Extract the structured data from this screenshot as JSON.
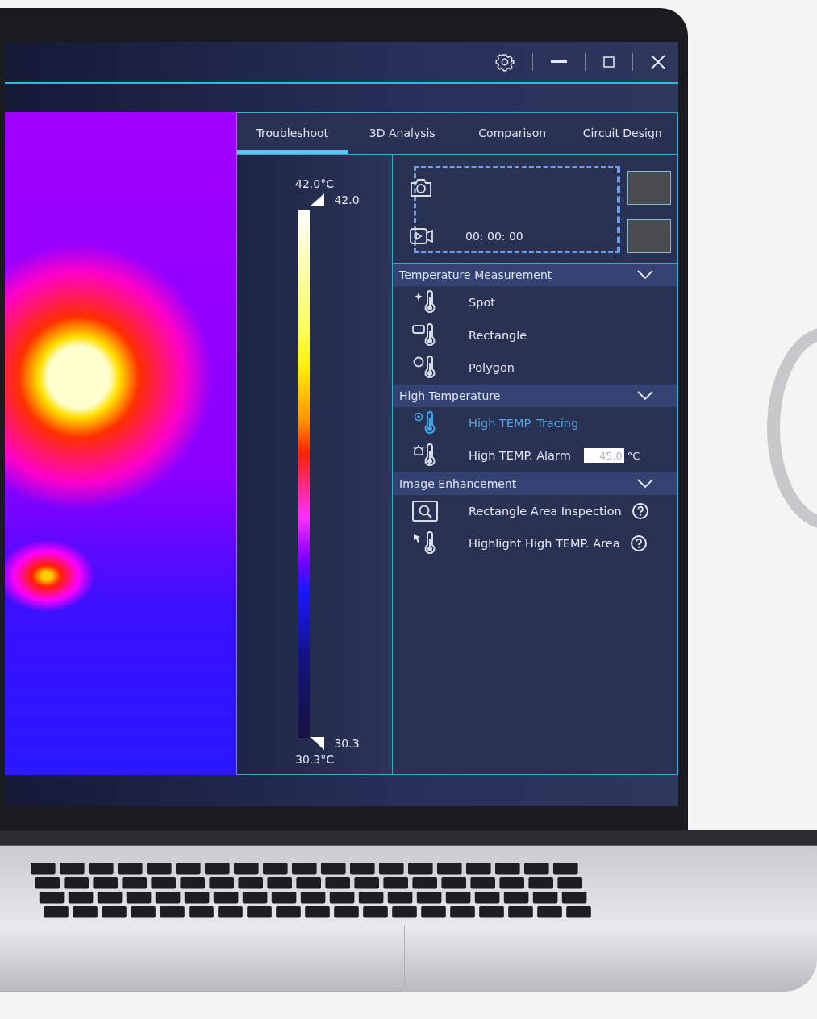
{
  "tabs": [
    {
      "label": "Troubleshoot",
      "selected": true
    },
    {
      "label": "3D Analysis",
      "selected": false
    },
    {
      "label": "Comparison",
      "selected": false
    },
    {
      "label": "Circuit Design",
      "selected": false
    }
  ],
  "color_scale": {
    "max_label": "42.0°C",
    "max_marker": "42.0",
    "min_marker": "30.3",
    "min_label": "30.3°C"
  },
  "capture": {
    "timer": "00: 00: 00"
  },
  "sections": [
    {
      "title": "Temperature Measurement",
      "expanded": true,
      "items": [
        {
          "kind": "spot",
          "label": "Spot",
          "selected": false
        },
        {
          "kind": "rectangle",
          "label": "Rectangle",
          "selected": false
        },
        {
          "kind": "polygon",
          "label": "Polygon",
          "selected": false
        }
      ]
    },
    {
      "title": "High Temperature",
      "expanded": true,
      "items": [
        {
          "kind": "tracing",
          "label": "High TEMP. Tracing",
          "selected": true
        },
        {
          "kind": "alarm",
          "label": "High TEMP. Alarm",
          "selected": false,
          "value": "45.0",
          "unit": "°C"
        }
      ]
    },
    {
      "title": "Image Enhancement",
      "expanded": true,
      "items": [
        {
          "kind": "inspection",
          "label": "Rectangle Area Inspection",
          "selected": false,
          "help": true
        },
        {
          "kind": "highlight",
          "label": "Highlight High TEMP. Area",
          "selected": false,
          "help": true
        }
      ]
    }
  ]
}
